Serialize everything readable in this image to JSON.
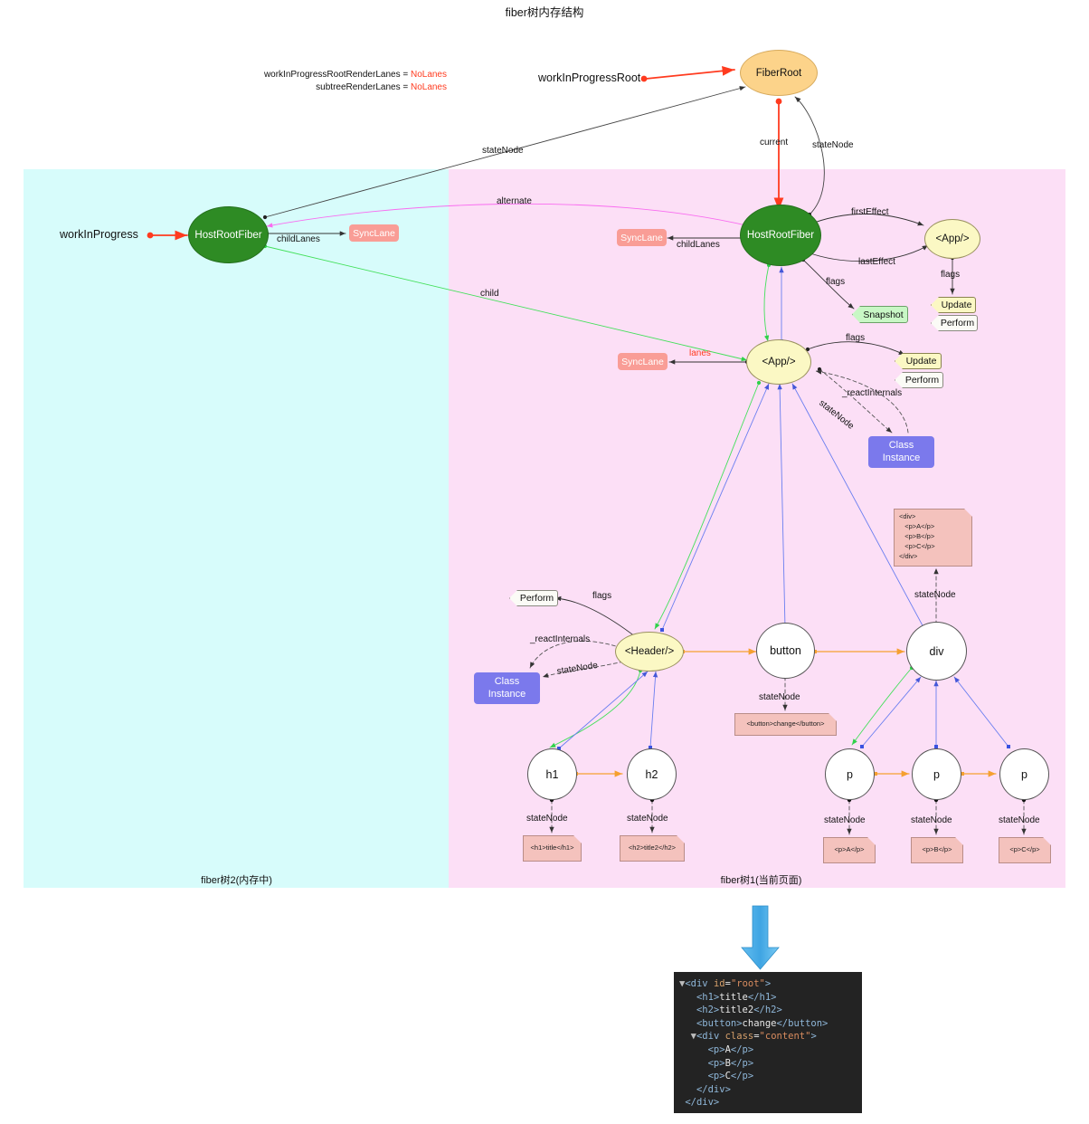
{
  "title": "fiber树内存结构",
  "panels": {
    "wip": {
      "caption": "fiber树2(内存中)",
      "bg": "#d7fcfb"
    },
    "current": {
      "caption": "fiber树1(当前页面)",
      "bg": "#fcdff6"
    }
  },
  "globals": {
    "line1_name": "workInProgressRootRenderLanes = ",
    "line1_value": "NoLanes",
    "line2_name": "subtreeRenderLanes = ",
    "line2_value": "NoLanes",
    "workInProgressRoot": "workInProgressRoot",
    "workInProgress": "workInProgress"
  },
  "nodes": {
    "fiberRoot": "FiberRoot",
    "hostRootFiber_wip": "HostRootFiber",
    "hostRootFiber_cur": "HostRootFiber",
    "app_effect": "<App/>",
    "app_fiber": "<App/>",
    "header": "<Header/>",
    "button": "button",
    "div": "div",
    "h1": "h1",
    "h2": "h2",
    "p1": "p",
    "p2": "p",
    "p3": "p",
    "syncLane_wip": "SyncLane",
    "syncLane_cur": "SyncLane",
    "syncLane_app": "SyncLane",
    "classInstance_app_l1": "Class",
    "classInstance_app_l2": "Instance",
    "classInstance_header_l1": "Class",
    "classInstance_header_l2": "Instance",
    "update_effect": "Update",
    "perform_effect": "Perform",
    "update_app": "Update",
    "perform_app": "Perform",
    "perform_header": "Perform",
    "snapshot": "Snapshot"
  },
  "edge_labels": {
    "stateNode_root": "stateNode",
    "stateNode_wip": "stateNode",
    "current": "current",
    "alternate": "alternate",
    "childLanes_wip": "childLanes",
    "childLanes_cur": "childLanes",
    "child": "child",
    "lanes": "lanes",
    "firstEffect": "firstEffect",
    "lastEffect": "lastEffect",
    "flags_hostroot": "flags",
    "flags_appeffect": "flags",
    "flags_app": "flags",
    "flags_header": "flags",
    "reactInternals_app": "_reactInternals",
    "stateNode_app": "stateNode",
    "reactInternals_header": "_reactInternals",
    "stateNode_header": "stateNode",
    "stateNode_div": "stateNode",
    "stateNode_button": "stateNode",
    "stateNode_h1": "stateNode",
    "stateNode_h2": "stateNode",
    "stateNode_p1": "stateNode",
    "stateNode_p2": "stateNode",
    "stateNode_p3": "stateNode"
  },
  "notes": {
    "div_note": "<div>\n   <p>A</p>\n   <p>B</p>\n   <p>C</p>\n</div>",
    "button_note": "<button>change</button>",
    "h1_note": "<h1>title</h1>",
    "h2_note": "<h2>title2</h2>",
    "p1_note": "<p>A</p>",
    "p2_note": "<p>B</p>",
    "p3_note": "<p>C</p>"
  },
  "dom": {
    "lines": [
      "▼<div id=\"root\">",
      "   <h1>title</h1>",
      "   <h2>title2</h2>",
      "   <button>change</button>",
      "  ▼<div class=\"content\">",
      "     <p>A</p>",
      "     <p>B</p>",
      "     <p>C</p>",
      "   </div>",
      " </div>"
    ]
  },
  "colors": {
    "accent_red": "#ff3b1f",
    "green_node": "#2e8b24",
    "orange_node": "#fcd38a",
    "yellow_node": "#fbf8c4",
    "lane_pink": "#f99d96",
    "class_purple": "#7b79ec",
    "sibling_orange": "#f5a030",
    "return_blue": "#6a7ef0",
    "child_green": "#43e05a",
    "alternate_magenta": "#f96cf0",
    "panel_wip": "#d7fcfb",
    "panel_current": "#fcdff6",
    "arrow_blue": "#4aa8e8"
  }
}
